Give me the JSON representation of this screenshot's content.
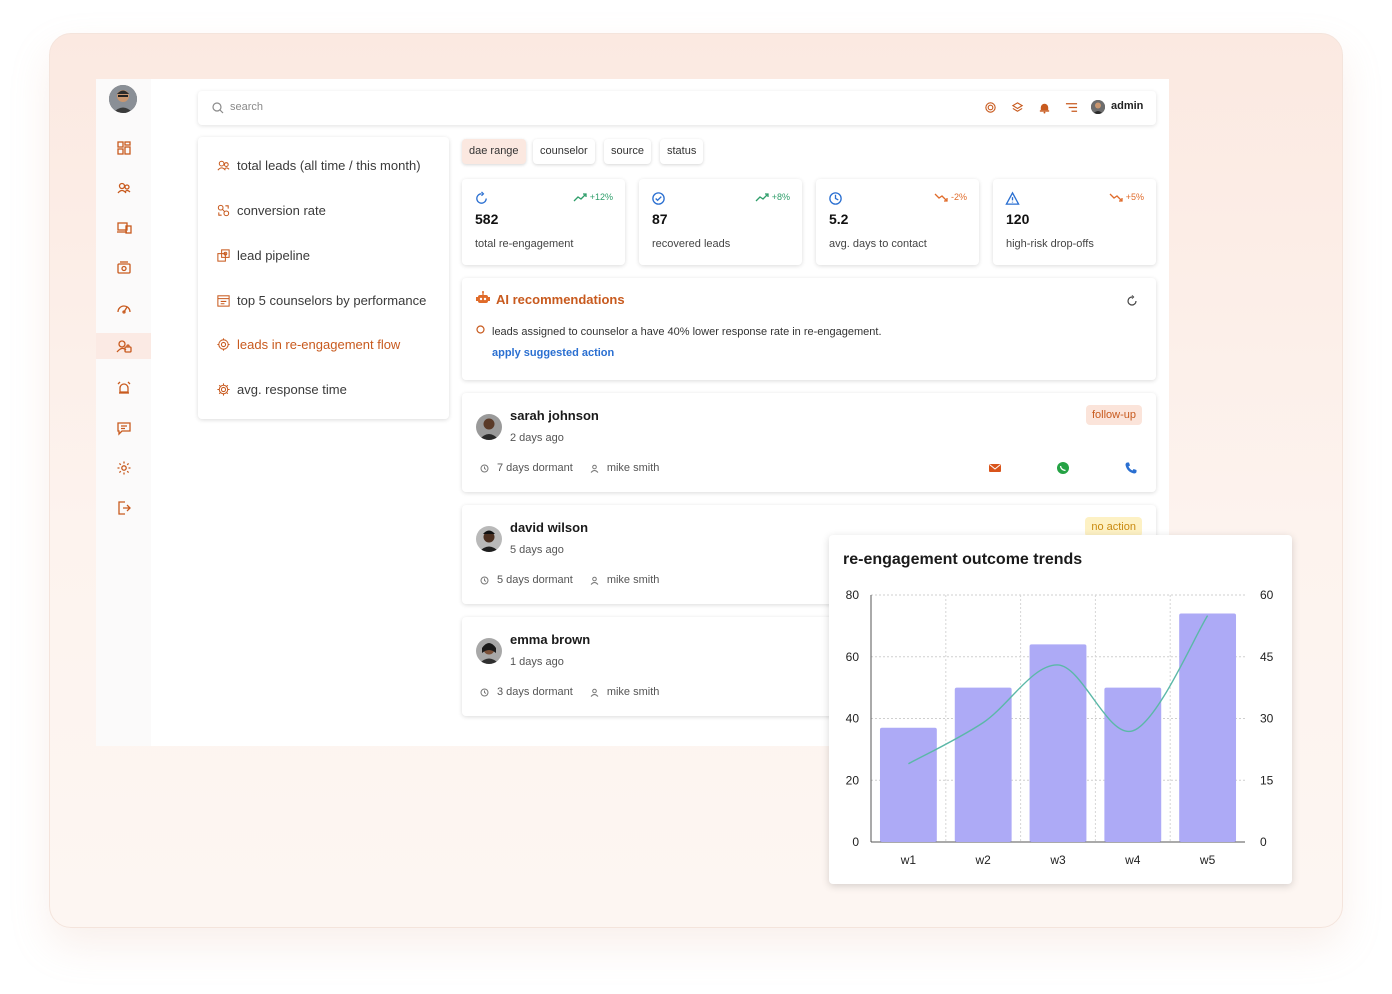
{
  "user": {
    "name": "admin"
  },
  "search": {
    "placeholder": "search"
  },
  "menu": {
    "items": [
      {
        "label": "total leads (all time / this month)",
        "icon": "users-icon"
      },
      {
        "label": "conversion rate",
        "icon": "conversion-icon"
      },
      {
        "label": "lead pipeline",
        "icon": "pipeline-icon"
      },
      {
        "label": "top 5 counselors by performance",
        "icon": "report-icon"
      },
      {
        "label": "leads in re-engagement flow",
        "icon": "gear-icon",
        "active": true
      },
      {
        "label": "avg. response time",
        "icon": "settings-icon"
      }
    ]
  },
  "filters": [
    {
      "label": "dae range",
      "active": true
    },
    {
      "label": "counselor"
    },
    {
      "label": "source"
    },
    {
      "label": "status"
    }
  ],
  "kpis": [
    {
      "value": "582",
      "label": "total re-engagement",
      "trend": "+12%",
      "trend_color": "#2e9e6a",
      "icon": "refresh-icon"
    },
    {
      "value": "87",
      "label": "recovered leads",
      "trend": "+8%",
      "trend_color": "#2e9e6a",
      "icon": "check-circle-icon"
    },
    {
      "value": "5.2",
      "label": "avg. days to contact",
      "trend": "-2%",
      "trend_color": "#e06b2a",
      "icon": "clock-icon"
    },
    {
      "value": "120",
      "label": "high-risk drop-offs",
      "trend": "+5%",
      "trend_color": "#e06b2a",
      "icon": "warning-icon"
    }
  ],
  "ai": {
    "title": "AI recommendations",
    "text": "leads assigned to counselor a have 40% lower response rate in re-engagement.",
    "action": "apply suggested action"
  },
  "leads": [
    {
      "name": "sarah johnson",
      "ago": "2 days ago",
      "dormant": "7 days dormant",
      "counselor": "mike smith",
      "badge": "follow-up",
      "badge_bg": "#fbe4da",
      "badge_color": "#c85a1e"
    },
    {
      "name": "david wilson",
      "ago": "5 days ago",
      "dormant": "5 days dormant",
      "counselor": "mike smith",
      "badge": "no action",
      "badge_bg": "#fdf1c4",
      "badge_color": "#c98a10"
    },
    {
      "name": "emma brown",
      "ago": "1 days ago",
      "dormant": "3 days dormant",
      "counselor": "mike smith"
    }
  ],
  "colors": {
    "accent": "#c85a1e",
    "bar": "#adaaf6",
    "line": "#5bb8a8",
    "link": "#2a6fd1"
  },
  "chart_data": {
    "type": "bar",
    "title": "re-engagement outcome trends",
    "categories": [
      "w1",
      "w2",
      "w3",
      "w4",
      "w5"
    ],
    "series": [
      {
        "type": "bar",
        "axis": "left",
        "values": [
          37,
          50,
          64,
          50,
          74
        ]
      },
      {
        "type": "line",
        "axis": "right",
        "values": [
          19,
          29,
          43,
          27,
          55
        ]
      }
    ],
    "ylim_left": [
      0,
      80
    ],
    "yticks_left": [
      0,
      20,
      40,
      60,
      80
    ],
    "ylim_right": [
      0,
      60
    ],
    "yticks_right": [
      0,
      15,
      30,
      45,
      60
    ],
    "grid": true
  }
}
